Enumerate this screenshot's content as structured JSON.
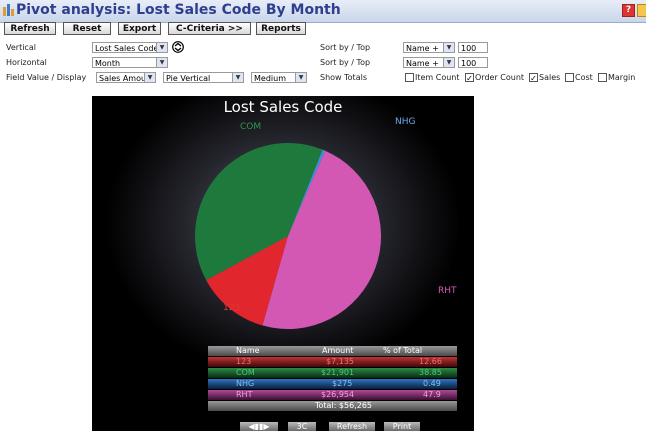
{
  "window": {
    "title": "Pivot analysis: Lost Sales Code By Month"
  },
  "toolbar": {
    "refresh_label": "Refresh",
    "reset_label": "Reset",
    "export_label": "Export",
    "criteria_label": "C-Criteria >>",
    "reports_label": "Reports"
  },
  "form": {
    "vertical_label": "Vertical",
    "vertical_value": "Lost Sales Code",
    "horizontal_label": "Horizontal",
    "horizontal_value": "Month",
    "field_label": "Field Value / Display",
    "field_value": "Sales Amount",
    "chart_type_value": "Pie Vertical",
    "size_value": "Medium",
    "sort1_label": "Sort by / Top",
    "sort1_value": "Name +",
    "top1_value": "100",
    "sort2_label": "Sort by / Top",
    "sort2_value": "Name +",
    "top2_value": "100",
    "show_totals_label": "Show Totals",
    "totals": [
      {
        "label": "Item Count",
        "checked": false
      },
      {
        "label": "Order Count",
        "checked": true
      },
      {
        "label": "Sales",
        "checked": true
      },
      {
        "label": "Cost",
        "checked": false
      },
      {
        "label": "Margin",
        "checked": false
      }
    ]
  },
  "chart_data": {
    "type": "pie",
    "title": "Lost Sales Code",
    "slices": [
      {
        "name": "123",
        "value": 7135,
        "percent": 12.66,
        "color": "#e2262d"
      },
      {
        "name": "COM",
        "value": 21901,
        "percent": 38.85,
        "color": "#1e7a3c"
      },
      {
        "name": "NHG",
        "value": 275,
        "percent": 0.49,
        "color": "#3d8fd6"
      },
      {
        "name": "RHT",
        "value": 26954,
        "percent": 47.9,
        "color": "#d358b4"
      }
    ],
    "table": {
      "headers": [
        "Name",
        "Amount",
        "% of Total"
      ],
      "rows": [
        [
          "123",
          "$7,135",
          "12.66"
        ],
        [
          "COM",
          "$21,901",
          "38.85"
        ],
        [
          "NHG",
          "$275",
          "0.49"
        ],
        [
          "RHT",
          "$26,954",
          "47.9"
        ]
      ],
      "total_label": "Total: $56,265"
    },
    "controls": [
      "◀▮▮▶",
      "3C",
      "Refresh",
      "Print"
    ]
  }
}
